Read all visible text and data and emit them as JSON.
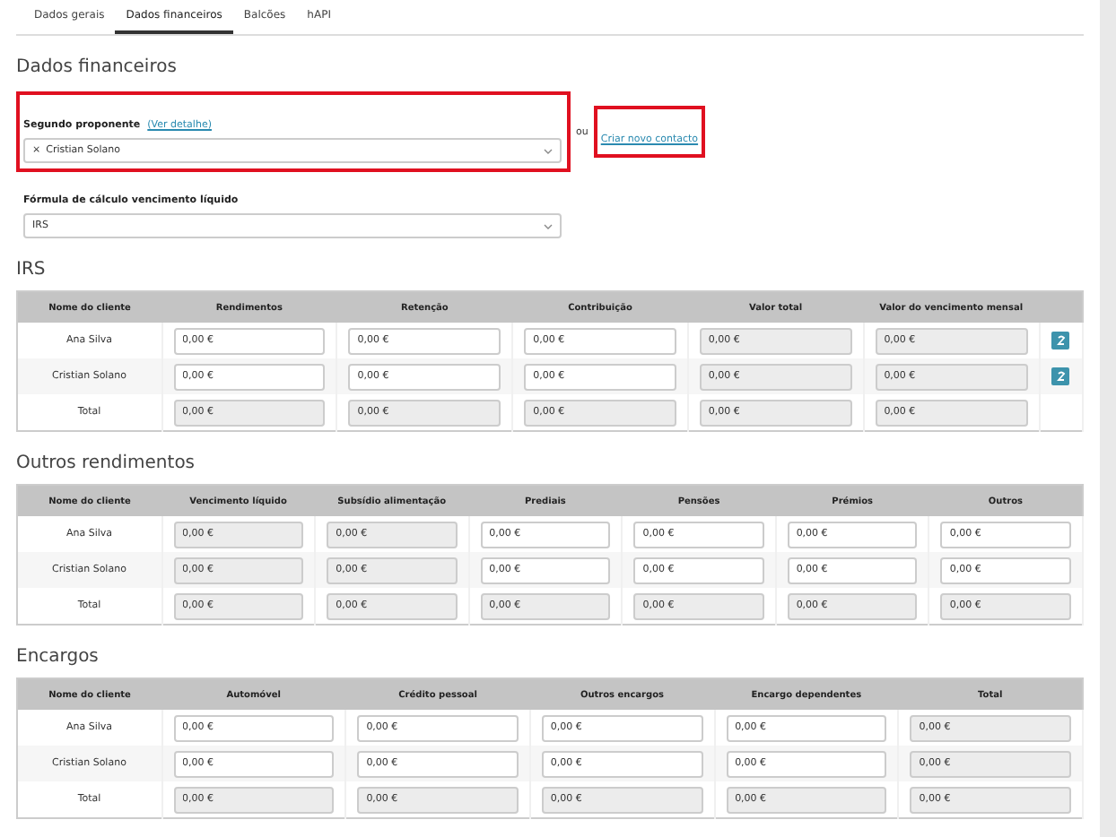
{
  "tabs": [
    {
      "label": "Dados gerais",
      "selected": false
    },
    {
      "label": "Dados financeiros",
      "selected": true
    },
    {
      "label": "Balcões",
      "selected": false
    },
    {
      "label": "hAPI",
      "selected": false
    }
  ],
  "title": "Dados financeiros",
  "second_proponent": {
    "label": "Segundo proponente",
    "detail_link": "(Ver detalhe)",
    "remove": "×",
    "value": "Cristian Solano",
    "highlighted": true,
    "or": "ou",
    "create_link": "Criar novo contacto",
    "create_highlighted": true
  },
  "formula": {
    "label": "Fórmula de cálculo vencimento líquido",
    "value": "IRS"
  },
  "sections": [
    {
      "title": "IRS",
      "columns": [
        "Nome do cliente",
        "Rendimentos",
        "Retenção",
        "Contribuição",
        "Valor total",
        "Valor do vencimento mensal"
      ],
      "rows": [
        {
          "action": true,
          "cells": [
            {
              "kind": "text",
              "value": "Ana Silva"
            },
            {
              "kind": "amount",
              "value": "0,00 €",
              "disabled": false
            },
            {
              "kind": "amount",
              "value": "0,00 €",
              "disabled": false
            },
            {
              "kind": "amount",
              "value": "0,00 €",
              "disabled": false
            },
            {
              "kind": "amount",
              "value": "0,00 €",
              "disabled": true
            },
            {
              "kind": "amount",
              "value": "0,00 €",
              "disabled": true
            }
          ]
        },
        {
          "action": true,
          "cells": [
            {
              "kind": "text",
              "value": "Cristian Solano"
            },
            {
              "kind": "amount",
              "value": "0,00 €",
              "disabled": false
            },
            {
              "kind": "amount",
              "value": "0,00 €",
              "disabled": false
            },
            {
              "kind": "amount",
              "value": "0,00 €",
              "disabled": false
            },
            {
              "kind": "amount",
              "value": "0,00 €",
              "disabled": true
            },
            {
              "kind": "amount",
              "value": "0,00 €",
              "disabled": true
            }
          ]
        },
        {
          "action": false,
          "cells": [
            {
              "kind": "text",
              "value": "Total"
            },
            {
              "kind": "amount",
              "value": "0,00 €",
              "disabled": true
            },
            {
              "kind": "amount",
              "value": "0,00 €",
              "disabled": true
            },
            {
              "kind": "amount",
              "value": "0,00 €",
              "disabled": true
            },
            {
              "kind": "amount",
              "value": "0,00 €",
              "disabled": true
            },
            {
              "kind": "amount",
              "value": "0,00 €",
              "disabled": true
            }
          ]
        }
      ]
    },
    {
      "title": "Outros rendimentos",
      "columns": [
        "Nome do cliente",
        "Vencimento líquido",
        "Subsídio alimentação",
        "Prediais",
        "Pensões",
        "Prémios",
        "Outros"
      ],
      "rows": [
        {
          "cells": [
            {
              "kind": "text",
              "value": "Ana Silva"
            },
            {
              "kind": "amount",
              "value": "0,00 €",
              "disabled": true
            },
            {
              "kind": "amount",
              "value": "0,00 €",
              "disabled": true
            },
            {
              "kind": "amount",
              "value": "0,00 €",
              "disabled": false
            },
            {
              "kind": "amount",
              "value": "0,00 €",
              "disabled": false
            },
            {
              "kind": "amount",
              "value": "0,00 €",
              "disabled": false
            },
            {
              "kind": "amount",
              "value": "0,00 €",
              "disabled": false
            }
          ]
        },
        {
          "cells": [
            {
              "kind": "text",
              "value": "Cristian Solano"
            },
            {
              "kind": "amount",
              "value": "0,00 €",
              "disabled": true
            },
            {
              "kind": "amount",
              "value": "0,00 €",
              "disabled": true
            },
            {
              "kind": "amount",
              "value": "0,00 €",
              "disabled": false
            },
            {
              "kind": "amount",
              "value": "0,00 €",
              "disabled": false
            },
            {
              "kind": "amount",
              "value": "0,00 €",
              "disabled": false
            },
            {
              "kind": "amount",
              "value": "0,00 €",
              "disabled": false
            }
          ]
        },
        {
          "cells": [
            {
              "kind": "text",
              "value": "Total"
            },
            {
              "kind": "amount",
              "value": "0,00 €",
              "disabled": true
            },
            {
              "kind": "amount",
              "value": "0,00 €",
              "disabled": true
            },
            {
              "kind": "amount",
              "value": "0,00 €",
              "disabled": true
            },
            {
              "kind": "amount",
              "value": "0,00 €",
              "disabled": true
            },
            {
              "kind": "amount",
              "value": "0,00 €",
              "disabled": true
            },
            {
              "kind": "amount",
              "value": "0,00 €",
              "disabled": true
            }
          ]
        }
      ]
    },
    {
      "title": "Encargos",
      "columns": [
        "Nome do cliente",
        "Automóvel",
        "Crédito pessoal",
        "Outros encargos",
        "Encargo dependentes",
        "Total"
      ],
      "rows": [
        {
          "cells": [
            {
              "kind": "text",
              "value": "Ana Silva"
            },
            {
              "kind": "amount",
              "value": "0,00 €",
              "disabled": false
            },
            {
              "kind": "amount",
              "value": "0,00 €",
              "disabled": false
            },
            {
              "kind": "amount",
              "value": "0,00 €",
              "disabled": false
            },
            {
              "kind": "amount",
              "value": "0,00 €",
              "disabled": false
            },
            {
              "kind": "amount",
              "value": "0,00 €",
              "disabled": true
            }
          ]
        },
        {
          "cells": [
            {
              "kind": "text",
              "value": "Cristian Solano"
            },
            {
              "kind": "amount",
              "value": "0,00 €",
              "disabled": false
            },
            {
              "kind": "amount",
              "value": "0,00 €",
              "disabled": false
            },
            {
              "kind": "amount",
              "value": "0,00 €",
              "disabled": false
            },
            {
              "kind": "amount",
              "value": "0,00 €",
              "disabled": false
            },
            {
              "kind": "amount",
              "value": "0,00 €",
              "disabled": true
            }
          ]
        },
        {
          "cells": [
            {
              "kind": "text",
              "value": "Total"
            },
            {
              "kind": "amount",
              "value": "0,00 €",
              "disabled": true
            },
            {
              "kind": "amount",
              "value": "0,00 €",
              "disabled": true
            },
            {
              "kind": "amount",
              "value": "0,00 €",
              "disabled": true
            },
            {
              "kind": "amount",
              "value": "0,00 €",
              "disabled": true
            },
            {
              "kind": "amount",
              "value": "0,00 €",
              "disabled": true
            }
          ]
        }
      ]
    }
  ]
}
